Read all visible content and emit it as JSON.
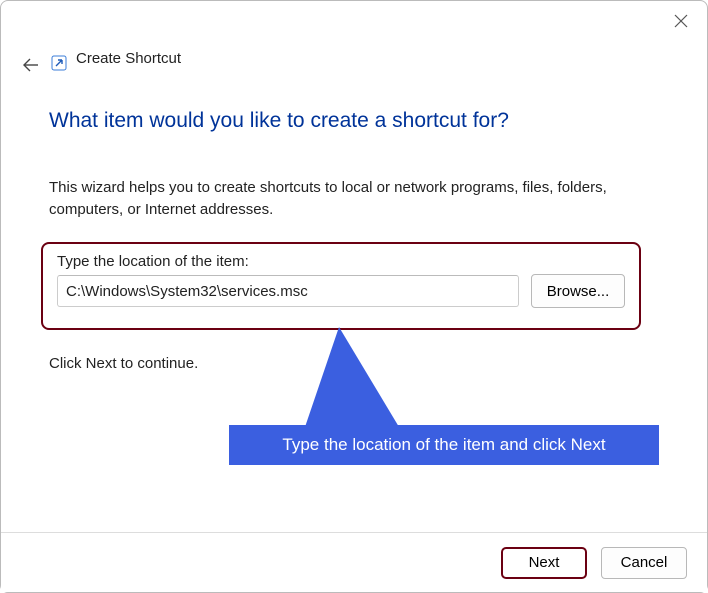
{
  "window": {
    "title": "Create Shortcut"
  },
  "heading": "What item would you like to create a shortcut for?",
  "intro": "This wizard helps you to create shortcuts to local or network programs, files, folders, computers, or Internet addresses.",
  "location": {
    "label": "Type the location of the item:",
    "value": "C:\\Windows\\System32\\services.msc",
    "browse": "Browse..."
  },
  "continue": "Click Next to continue.",
  "callout": "Type the location of the item and click Next",
  "footer": {
    "next": "Next",
    "cancel": "Cancel"
  }
}
